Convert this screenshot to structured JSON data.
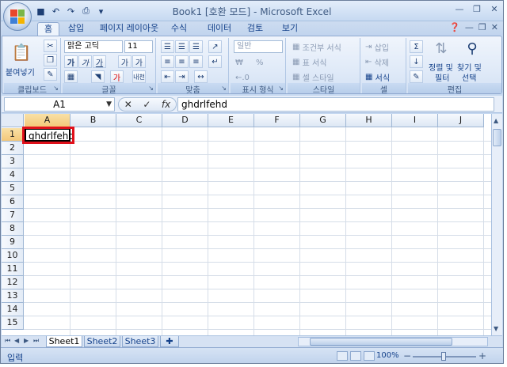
{
  "window": {
    "title": "Book1  [호환 모드] - Microsoft Excel"
  },
  "qat": {
    "items": [
      "save-icon",
      "undo-icon",
      "redo-icon",
      "print-icon",
      "dropdown-icon"
    ]
  },
  "tabs": [
    {
      "label": "홈",
      "active": true
    },
    {
      "label": "삽입"
    },
    {
      "label": "페이지 레이아웃"
    },
    {
      "label": "수식"
    },
    {
      "label": "데이터"
    },
    {
      "label": "검토"
    },
    {
      "label": "보기"
    }
  ],
  "ribbon": {
    "clipboard": {
      "group_label": "클립보드",
      "paste_label": "붙여넣기"
    },
    "font": {
      "group_label": "글꼴",
      "font_name": "맑은 고딕",
      "font_size": "11",
      "bold": "가",
      "italic": "가",
      "underline": "가",
      "grow": "가",
      "shrink": "가",
      "color_char": "가",
      "phonetic": "내천"
    },
    "align": {
      "group_label": "맞춤"
    },
    "number": {
      "group_label": "표시 형식",
      "format": "일반",
      "currency": "₩",
      "percent": "%"
    },
    "styles": {
      "group_label": "스타일",
      "conditional": "조건부 서식",
      "table": "표 서식",
      "cell_style": "셀 스타일"
    },
    "cells": {
      "group_label": "셀",
      "insert": "삽입",
      "delete": "삭제",
      "format": "서식"
    },
    "editing": {
      "group_label": "편집",
      "sort_filter_1": "정렬 및",
      "sort_filter_2": "필터",
      "find_1": "찾기 및",
      "find_2": "선택"
    }
  },
  "formula_bar": {
    "name_box": "A1",
    "formula": "ghdrlfehd",
    "fx": "fx"
  },
  "grid": {
    "columns": [
      "A",
      "B",
      "C",
      "D",
      "E",
      "F",
      "G",
      "H",
      "I",
      "J"
    ],
    "rows": [
      "1",
      "2",
      "3",
      "4",
      "5",
      "6",
      "7",
      "8",
      "9",
      "10",
      "11",
      "12",
      "13",
      "14",
      "15"
    ],
    "selected_column": "A",
    "selected_row": "1",
    "cells": {
      "A1": "ghdrlfehd"
    }
  },
  "sheets": [
    {
      "label": "Sheet1",
      "active": true
    },
    {
      "label": "Sheet2"
    },
    {
      "label": "Sheet3"
    }
  ],
  "status": {
    "mode": "입력",
    "zoom": "100%"
  },
  "colors": {
    "highlight": "#e0101a",
    "ribbon_bg": "#dbe6f6",
    "frame": "#c5d8f0"
  }
}
